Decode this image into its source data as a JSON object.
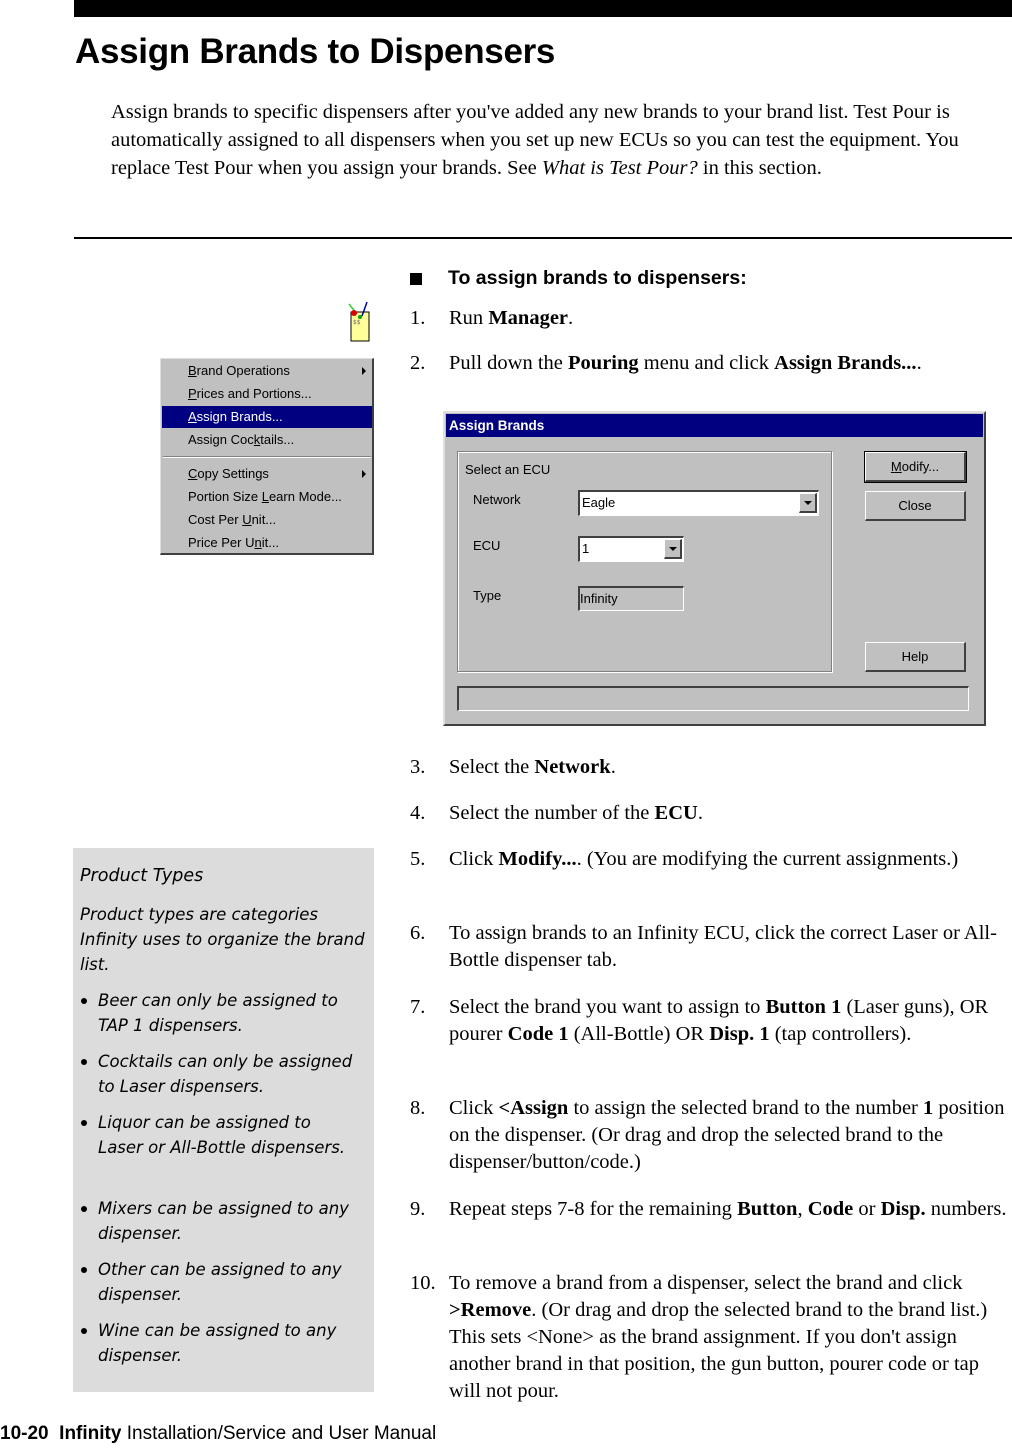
{
  "page_title": "Assign Brands to Dispensers",
  "intro": {
    "text_1": "Assign brands to specific dispensers after you've added any new brands to your brand list. Test Pour is automatically assigned to all dispensers when you set up new ECUs so you can test the equipment. You replace Test Pour when you assign your brands. See ",
    "link_text": "What is Test Pour?",
    "text_2": " in this section."
  },
  "procedure": {
    "heading": "To assign brands to dispensers:",
    "steps": [
      {
        "num": "1.",
        "parts": [
          "Run ",
          {
            "b": "Manager"
          },
          "."
        ]
      },
      {
        "num": "2.",
        "parts": [
          "Pull down the ",
          {
            "b": "Pouring"
          },
          " menu and click ",
          {
            "b": "Assign Brands..."
          },
          "."
        ]
      },
      {
        "num": "3.",
        "parts": [
          "Select the ",
          {
            "b": "Network"
          },
          "."
        ]
      },
      {
        "num": "4.",
        "parts": [
          "Select the number of the ",
          {
            "b": "ECU"
          },
          "."
        ]
      },
      {
        "num": "5.",
        "parts": [
          "Click ",
          {
            "b": "Modify..."
          },
          ". (You are modifying the current assignments.)"
        ]
      },
      {
        "num": "6.",
        "parts": [
          "To assign brands to an Infinity ECU, click the correct Laser or All-Bottle dispenser tab."
        ]
      },
      {
        "num": "7.",
        "parts": [
          "Select the brand you want to assign to ",
          {
            "b": "Button 1"
          },
          " (Laser guns), OR pourer ",
          {
            "b": "Code 1"
          },
          " (All-Bottle) OR ",
          {
            "b": "Disp. 1"
          },
          " (tap controllers)."
        ]
      },
      {
        "num": "8.",
        "parts": [
          "Click ",
          {
            "b": "<Assign"
          },
          " to assign the selected brand to the number ",
          {
            "b": "1"
          },
          " position on the dispenser. (Or drag and drop the selected brand to the dispenser/button/code.)"
        ]
      },
      {
        "num": "9.",
        "parts": [
          "Repeat steps 7-8 for the remaining ",
          {
            "b": "Button"
          },
          ", ",
          {
            "b": "Code"
          },
          " or ",
          {
            "b": "Disp."
          },
          " numbers."
        ]
      },
      {
        "num": "10.",
        "parts": [
          "To remove a brand from a dispenser, select the brand and click ",
          {
            "b": ">Remove"
          },
          ". (Or drag and drop the selected brand to the brand list.) This sets <None> as the brand assignment. If you don't assign another brand in that position, the gun button, pourer code or tap will not pour."
        ]
      }
    ]
  },
  "manager_icon": "manager-app-icon",
  "pouring_menu": {
    "items": [
      {
        "label": "Brand Operations",
        "mnemonic": 0,
        "submenu": true,
        "selected": false
      },
      {
        "label": "Prices and Portions...",
        "mnemonic": 0,
        "submenu": false,
        "selected": false
      },
      {
        "label": "Assign Brands...",
        "mnemonic": 0,
        "submenu": false,
        "selected": true
      },
      {
        "label": "Assign Cocktails...",
        "mnemonic": 10,
        "submenu": false,
        "selected": false
      },
      {
        "label": "Copy Settings",
        "mnemonic": 0,
        "submenu": true,
        "selected": false
      },
      {
        "label": "Portion Size Learn Mode...",
        "mnemonic": 13,
        "submenu": false,
        "selected": false
      },
      {
        "label": "Cost Per Unit...",
        "mnemonic": 9,
        "submenu": false,
        "selected": false
      },
      {
        "label": "Price Per Unit...",
        "mnemonic": 11,
        "submenu": false,
        "selected": false
      }
    ],
    "selected_color": "#000080"
  },
  "dialog": {
    "title": "Assign Brands",
    "group_label": "Select an ECU",
    "network_label": "Network",
    "network_value": "Eagle",
    "ecu_label": "ECU",
    "ecu_value": "1",
    "type_label": "Type",
    "type_value": "Infinity",
    "modify_button": "Modify...",
    "close_button": "Close",
    "help_button": "Help",
    "status_text": "",
    "titlebar_color": "#000080"
  },
  "note": {
    "title": "Product Types",
    "body": "Product types are categories Infinity uses to organize the brand list.",
    "items": [
      "Beer can only be assigned to TAP 1 dispensers.",
      "Cocktails can only be assigned to Laser dispensers.",
      "Liquor can be assigned to Laser or All-Bottle dispensers.",
      "Mixers can be assigned to any dispenser.",
      "Other can be assigned to any dispenser.",
      "Wine can be assigned to any dispenser."
    ]
  },
  "footer": {
    "page_number": "10-20",
    "product": "Infinity",
    "manual_title": "Installation/Service and User Manual"
  }
}
